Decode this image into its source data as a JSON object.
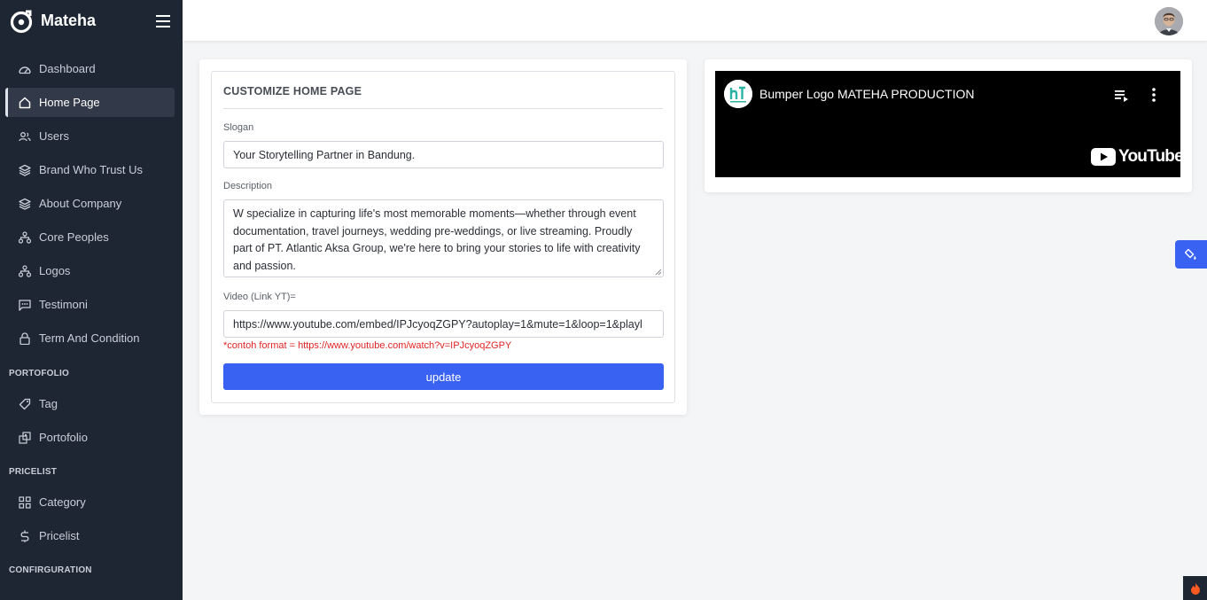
{
  "brand": {
    "name": "Mateha"
  },
  "sidebar": {
    "items": [
      {
        "label": "Dashboard",
        "icon": "dashboard-icon"
      },
      {
        "label": "Home Page",
        "icon": "home-icon",
        "active": true
      },
      {
        "label": "Users",
        "icon": "users-icon"
      },
      {
        "label": "Brand Who Trust Us",
        "icon": "layers-icon"
      },
      {
        "label": "About Company",
        "icon": "layers-icon"
      },
      {
        "label": "Core Peoples",
        "icon": "hierarchy-icon"
      },
      {
        "label": "Logos",
        "icon": "hierarchy-icon"
      },
      {
        "label": "Testimoni",
        "icon": "message-icon"
      },
      {
        "label": "Term And Condition",
        "icon": "lock-icon"
      }
    ],
    "sections": {
      "portofolio": {
        "title": "PORTOFOLIO",
        "items": [
          {
            "label": "Tag",
            "icon": "tag-icon"
          },
          {
            "label": "Portofolio",
            "icon": "gallery-icon"
          }
        ]
      },
      "pricelist": {
        "title": "PRICELIST",
        "items": [
          {
            "label": "Category",
            "icon": "grid-icon"
          },
          {
            "label": "Pricelist",
            "icon": "dollar-icon"
          }
        ]
      },
      "configuration": {
        "title": "CONFIRGURATION"
      }
    }
  },
  "form": {
    "title": "CUSTOMIZE HOME PAGE",
    "slogan_label": "Slogan",
    "slogan_value": "Your Storytelling Partner in Bandung.",
    "description_label": "Description",
    "description_value": "W specialize in capturing life's most memorable moments—whether through event documentation, travel journeys, wedding pre-weddings, or live streaming. Proudly part of PT. Atlantic Aksa Group, we're here to bring your stories to life with creativity and passion.",
    "video_label": "Video (Link YT)=",
    "video_value": "https://www.youtube.com/embed/IPJcyoqZGPY?autoplay=1&mute=1&loop=1&playl",
    "video_hint": "*contoh format = https://www.youtube.com/watch?v=IPJcyoqZGPY",
    "update_label": "update"
  },
  "video": {
    "title": "Bumper Logo MATEHA PRODUCTION",
    "youtube_label": "YouTube"
  },
  "colors": {
    "sidebar": "#1f2633",
    "accent": "#3a62f2",
    "hint": "#e02424"
  }
}
